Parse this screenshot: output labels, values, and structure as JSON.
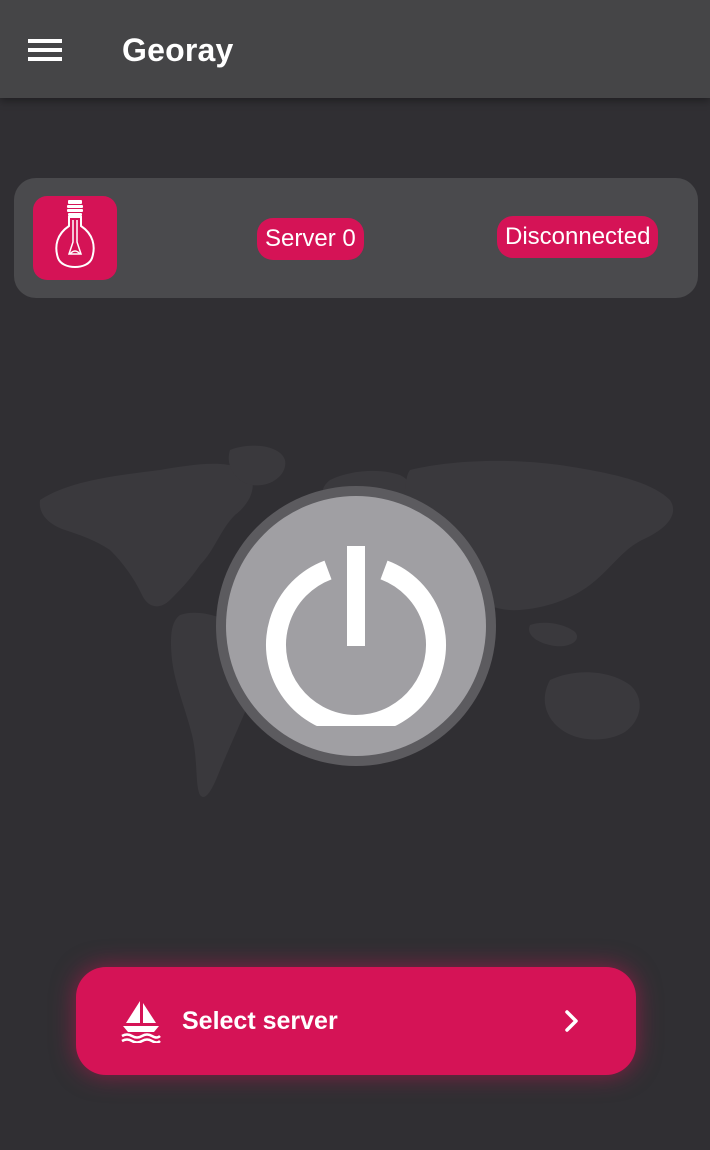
{
  "app": {
    "title": "Georay"
  },
  "appbar": {
    "menu_icon": "hamburger-menu-icon"
  },
  "status_card": {
    "icon": "lightbulb-icon",
    "server_label": "Server 0",
    "connection_status": "Disconnected"
  },
  "main": {
    "background_image": "world-map",
    "power_icon": "power-icon"
  },
  "select_server": {
    "icon": "sailboat-icon",
    "label": "Select server",
    "arrow_icon": "chevron-right-icon"
  },
  "colors": {
    "accent": "#d51356",
    "background": "#302f33",
    "appbar": "#454547",
    "card": "#4a4a4d",
    "power_button": "#a09fa3"
  }
}
